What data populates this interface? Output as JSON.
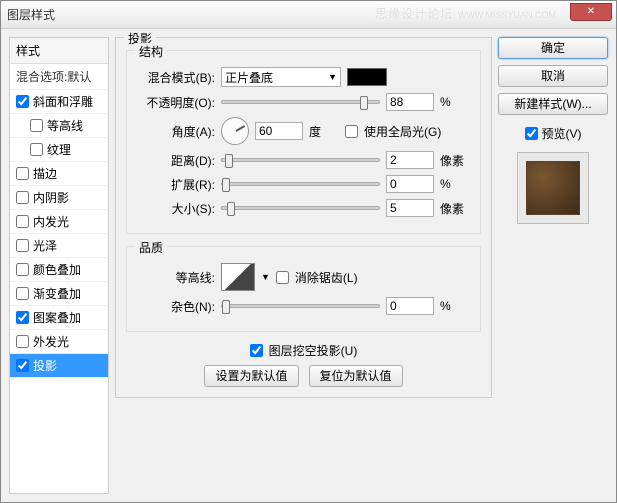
{
  "title": "图层样式",
  "watermark": {
    "main": "思缘设计论坛",
    "sub": "WWW.MISSYUAN.COM"
  },
  "sidebar": {
    "header": "样式",
    "sub": "混合选项:默认",
    "items": [
      {
        "label": "斜面和浮雕",
        "checked": true
      },
      {
        "label": "等高线",
        "checked": false,
        "indent": true
      },
      {
        "label": "纹理",
        "checked": false,
        "indent": true
      },
      {
        "label": "描边",
        "checked": false
      },
      {
        "label": "内阴影",
        "checked": false
      },
      {
        "label": "内发光",
        "checked": false
      },
      {
        "label": "光泽",
        "checked": false
      },
      {
        "label": "颜色叠加",
        "checked": false
      },
      {
        "label": "渐变叠加",
        "checked": false
      },
      {
        "label": "图案叠加",
        "checked": true
      },
      {
        "label": "外发光",
        "checked": false
      },
      {
        "label": "投影",
        "checked": true,
        "selected": true
      }
    ]
  },
  "panel": {
    "title": "投影",
    "structure": {
      "title": "结构",
      "blendMode": {
        "label": "混合模式(B):",
        "value": "正片叠底"
      },
      "opacity": {
        "label": "不透明度(O):",
        "value": "88",
        "unit": "%",
        "pos": 88
      },
      "angle": {
        "label": "角度(A):",
        "value": "60",
        "unit": "度"
      },
      "globalLight": {
        "label": "使用全局光(G)",
        "checked": false
      },
      "distance": {
        "label": "距离(D):",
        "value": "2",
        "unit": "像素",
        "pos": 2
      },
      "spread": {
        "label": "扩展(R):",
        "value": "0",
        "unit": "%",
        "pos": 0
      },
      "size": {
        "label": "大小(S):",
        "value": "5",
        "unit": "像素",
        "pos": 3
      }
    },
    "quality": {
      "title": "品质",
      "contour": {
        "label": "等高线:"
      },
      "antialias": {
        "label": "消除锯齿(L)",
        "checked": false
      },
      "noise": {
        "label": "杂色(N):",
        "value": "0",
        "unit": "%",
        "pos": 0
      }
    },
    "knockout": {
      "label": "图层挖空投影(U)",
      "checked": true
    },
    "btnDefault": "设置为默认值",
    "btnReset": "复位为默认值"
  },
  "buttons": {
    "ok": "确定",
    "cancel": "取消",
    "newStyle": "新建样式(W)...",
    "preview": "预览(V)"
  }
}
